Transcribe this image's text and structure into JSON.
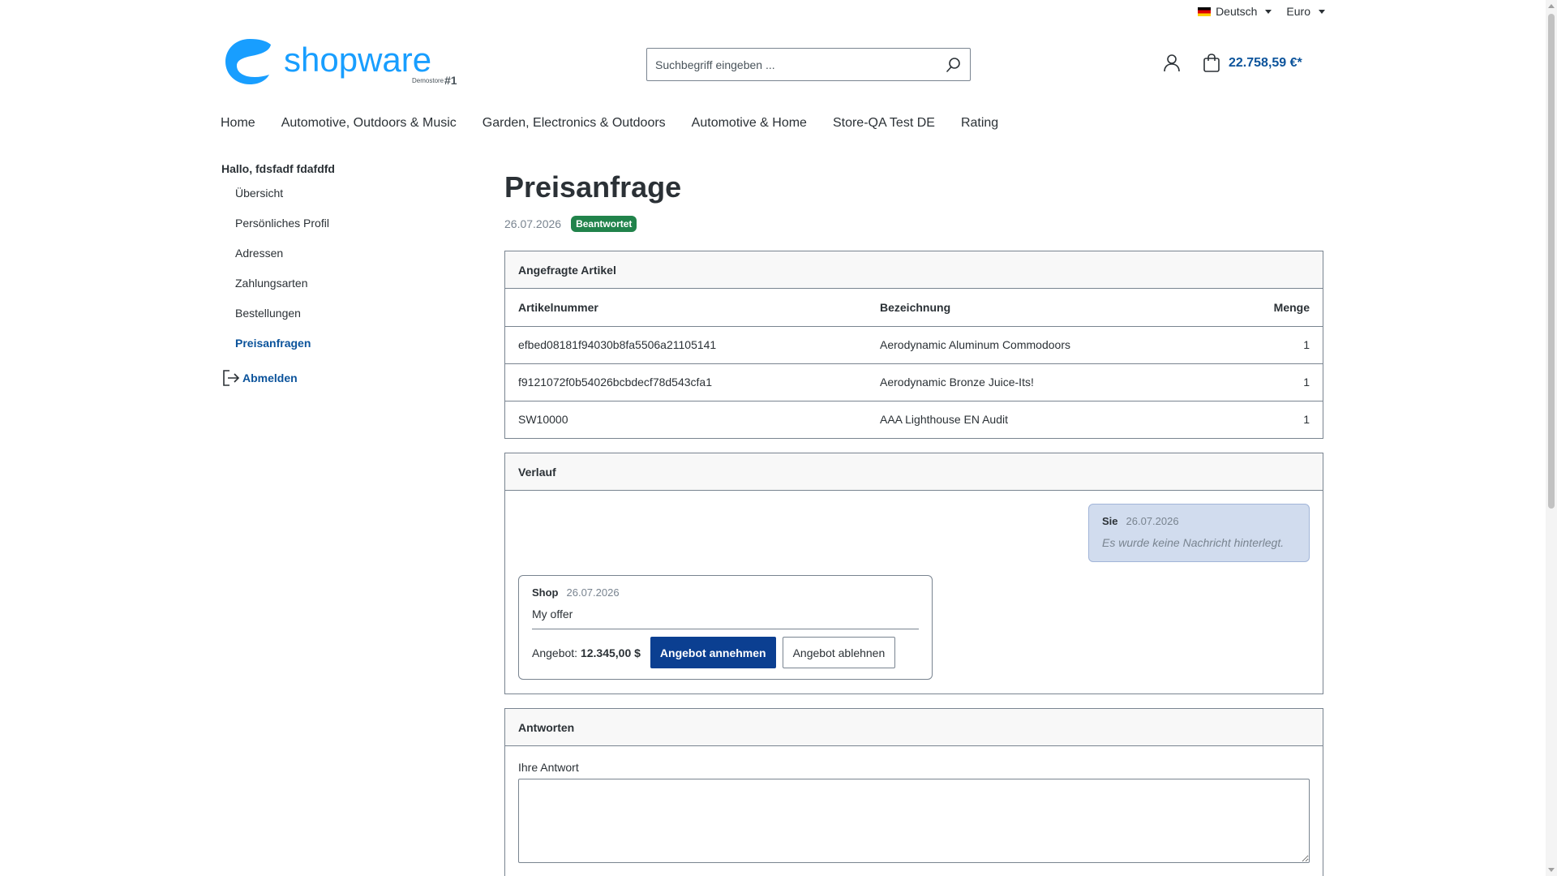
{
  "topbar": {
    "language": "Deutsch",
    "currency": "Euro"
  },
  "logo": {
    "text": "shopware",
    "sub": "Demostore",
    "badge": "#1"
  },
  "search": {
    "placeholder": "Suchbegriff eingeben ..."
  },
  "cart": {
    "total": "22.758,59 €*"
  },
  "nav": [
    "Home",
    "Automotive, Outdoors & Music",
    "Garden, Electronics & Outdoors",
    "Automotive & Home",
    "Store-QA Test DE",
    "Rating"
  ],
  "sidebar": {
    "hello": "Hallo, fdsfadf fdafdfd",
    "items": [
      "Übersicht",
      "Persönliches Profil",
      "Adressen",
      "Zahlungsarten",
      "Bestellungen",
      "Preisanfragen"
    ],
    "logout": "Abmelden"
  },
  "page": {
    "title": "Preisanfrage",
    "date": "26.07.2026",
    "status": "Beantwortet"
  },
  "articles": {
    "header": "Angefragte Artikel",
    "columns": [
      "Artikelnummer",
      "Bezeichnung",
      "Menge"
    ],
    "rows": [
      [
        "efbed08181f94030b8fa5506a21105141",
        "Aerodynamic Aluminum Commodoors",
        "1"
      ],
      [
        "f9121072f0b54026bcbdecf78d543cfa1",
        "Aerodynamic Bronze Juice-Its!",
        "1"
      ],
      [
        "SW10000",
        "AAA Lighthouse EN Audit",
        "1"
      ]
    ]
  },
  "history": {
    "header": "Verlauf",
    "customer_msg": {
      "author": "Sie",
      "date": "26.07.2026",
      "text": "Es wurde keine Nachricht hinterlegt."
    },
    "shop_msg": {
      "author": "Shop",
      "date": "26.07.2026",
      "text": "My offer",
      "offer_label": "Angebot:",
      "offer_value": "12.345,00 $",
      "accept": "Angebot annehmen",
      "decline": "Angebot ablehnen"
    }
  },
  "reply": {
    "header": "Antworten",
    "label": "Ihre Antwort"
  },
  "colors": {
    "accent": "#0b539b",
    "primary_button": "#0b3f91",
    "badge": "#21834b",
    "logo": "#189eff"
  }
}
